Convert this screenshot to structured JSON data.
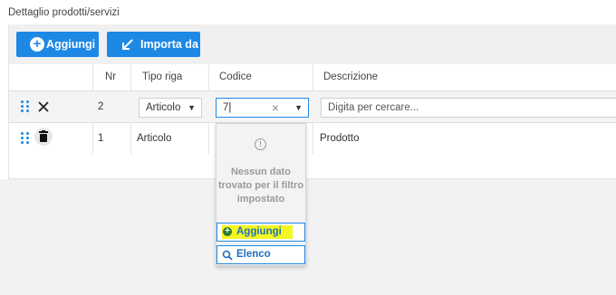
{
  "section": {
    "title": "Dettaglio prodotti/servizi"
  },
  "toolbar": {
    "add_label": "Aggiungi",
    "import_label": "Importa da"
  },
  "table": {
    "columns": [
      "Nr",
      "Tipo riga",
      "Codice",
      "Descrizione"
    ],
    "edit_row": {
      "nr": "2",
      "tipo_riga": "Articolo",
      "codice_value": "7",
      "descrizione_placeholder": "Digita per cercare..."
    },
    "rows": [
      {
        "nr": "1",
        "tipo_riga": "Articolo",
        "descrizione": "Prodotto"
      }
    ]
  },
  "dropdown": {
    "empty_message": "Nessun dato trovato per il filtro impostato",
    "add_label": "Aggiungi",
    "list_label": "Elenco"
  },
  "colors": {
    "primary": "#1e88e5",
    "highlight": "#f4f71f",
    "add_green": "#2e7d32"
  },
  "icons": [
    "drag-handle-icon",
    "close-icon",
    "trash-icon",
    "plus-circle-icon",
    "arrow-import-icon",
    "caret-down-icon",
    "clear-icon",
    "info-icon",
    "search-icon"
  ]
}
